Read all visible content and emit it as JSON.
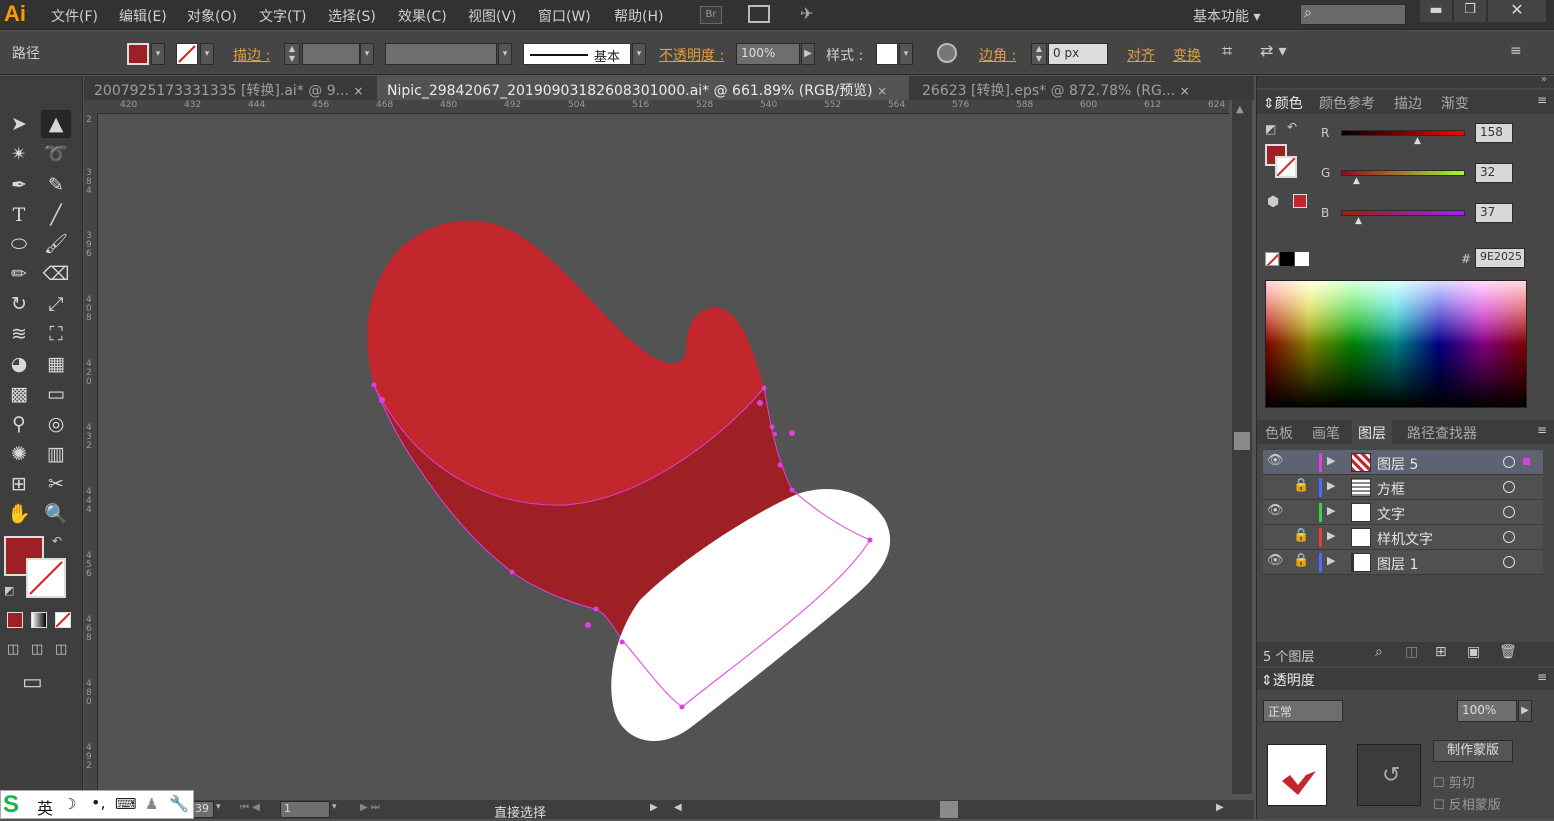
{
  "app": {
    "logo": "Ai",
    "menu": [
      "文件(F)",
      "编辑(E)",
      "对象(O)",
      "文字(T)",
      "选择(S)",
      "效果(C)",
      "视图(V)",
      "窗口(W)",
      "帮助(H)"
    ],
    "bridge_icon": "Br",
    "workspace": "基本功能",
    "window_controls": [
      "minimize-icon",
      "restore-icon",
      "close-icon"
    ]
  },
  "control": {
    "object_type": "路径",
    "stroke_label": "描边 :",
    "stroke_style": "基本",
    "opacity_label": "不透明度 :",
    "opacity_value": "100%",
    "style_label": "样式 :",
    "corner_label": "边角 :",
    "corner_value": "0 px",
    "align_label": "对齐",
    "transform_label": "变换"
  },
  "tabs": [
    {
      "label": "2007925173331335 [转换].ai* @ 9...",
      "close": "×"
    },
    {
      "label": "Nipic_29842067_20190903182608301000.ai* @ 661.89% (RGB/预览)",
      "close": "×"
    },
    {
      "label": "26623 [转换].eps* @ 872.78% (RG...",
      "close": "×"
    }
  ],
  "ruler": {
    "top": [
      "420",
      "432",
      "444",
      "456",
      "468",
      "480",
      "492",
      "504",
      "516",
      "528",
      "540",
      "552",
      "564",
      "576",
      "588",
      "600",
      "612",
      "624"
    ],
    "left": [
      "2",
      "3 8 4",
      "3 9 6",
      "4 0 8",
      "4 2 0",
      "4 3 2",
      "4 4 4",
      "4 5 6",
      "4 6 8",
      "4 8 0",
      "4 9 2"
    ]
  },
  "colors": {
    "mitten_red": "#C1272D",
    "mitten_dark": "#9E2025",
    "cuff": "#FFFFFF",
    "canvas": "#535353",
    "path": "#E040E0",
    "fill_swatch": "#9E2025"
  },
  "color_panel": {
    "tabs": [
      "颜色",
      "颜色参考",
      "描边",
      "渐变"
    ],
    "channels": [
      {
        "name": "R",
        "value": 158
      },
      {
        "name": "G",
        "value": 32
      },
      {
        "name": "B",
        "value": 37
      }
    ],
    "hex_label": "#",
    "hex": "9E2025"
  },
  "layers_panel": {
    "tabs": [
      "色板",
      "画笔",
      "图层",
      "路径查找器"
    ],
    "layers": [
      {
        "name": "图层 5",
        "visible": true,
        "locked": false,
        "color": "#e040e0",
        "active": true
      },
      {
        "name": "方框",
        "visible": false,
        "locked": true,
        "color": "#4a6cff",
        "active": false
      },
      {
        "name": "文字",
        "visible": true,
        "locked": false,
        "color": "#39d839",
        "active": false
      },
      {
        "name": "样机文字",
        "visible": false,
        "locked": true,
        "color": "#e04040",
        "active": false
      },
      {
        "name": "图层 1",
        "visible": true,
        "locked": true,
        "color": "#4a6cff",
        "active": false
      }
    ],
    "count": "5 个图层"
  },
  "transparency": {
    "title": "透明度",
    "mode": "正常",
    "opacity": "100%",
    "make_mask": "制作蒙版",
    "clip": "剪切",
    "invert_mask": "反相蒙版"
  },
  "status": {
    "zoom": "39",
    "artboard": "1",
    "tool": "直接选择"
  },
  "ime": {
    "lang": "英"
  }
}
